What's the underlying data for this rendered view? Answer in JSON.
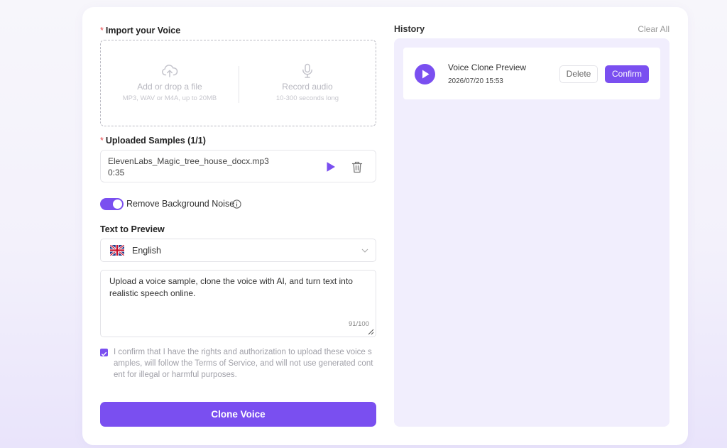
{
  "import": {
    "label": "Import your Voice",
    "required_mark": "*",
    "upload": {
      "title": "Add or drop a file",
      "subtitle": "MP3, WAV or M4A, up to 20MB",
      "icon": "cloud-upload-icon"
    },
    "record": {
      "title": "Record audio",
      "subtitle": "10-300 seconds long",
      "icon": "microphone-icon"
    }
  },
  "samples": {
    "label": "Uploaded Samples (1/1)",
    "required_mark": "*",
    "items": [
      {
        "filename": "ElevenLabs_Magic_tree_house_docx.mp3",
        "duration": "0:35"
      }
    ]
  },
  "noise_toggle": {
    "label": "Remove Background Noise",
    "enabled": true
  },
  "preview": {
    "label": "Text to Preview",
    "language": "English",
    "text": "Upload a voice sample, clone the voice with AI, and turn text into realistic speech online.",
    "char_count": "91/100"
  },
  "consent": {
    "checked": true,
    "text": "I confirm that I have the rights and authorization to upload these voice samples, will follow the Terms of Service, and will not use generated content for illegal or harmful purposes."
  },
  "clone_button": "Clone Voice",
  "history": {
    "title": "History",
    "clear_all": "Clear All",
    "items": [
      {
        "title": "Voice Clone Preview",
        "date": "2026/07/20 15:53",
        "delete_label": "Delete",
        "confirm_label": "Confirm"
      }
    ]
  },
  "colors": {
    "accent": "#7a4ff0",
    "panel": "#f1eefd",
    "required": "#e5484d"
  }
}
